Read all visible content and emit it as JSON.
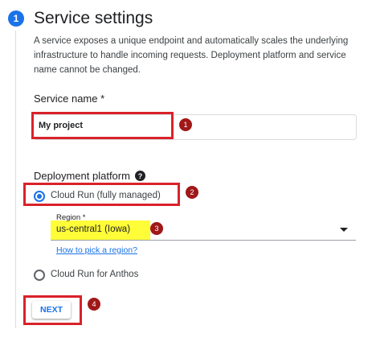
{
  "step": {
    "number": "1",
    "title": "Service settings"
  },
  "description": "A service exposes a unique endpoint and automatically scales the underlying infrastructure to handle incoming requests. Deployment platform and service name cannot be changed.",
  "service_name": {
    "label": "Service name *",
    "value": "My project"
  },
  "deployment": {
    "label": "Deployment platform",
    "help_icon_glyph": "?",
    "options": [
      {
        "label": "Cloud Run (fully managed)",
        "selected": true
      },
      {
        "label": "Cloud Run for Anthos",
        "selected": false
      }
    ],
    "region": {
      "label": "Region *",
      "value": "us-central1 (Iowa)",
      "help_link": "How to pick a region?"
    }
  },
  "next_button": "NEXT",
  "annotations": [
    "1",
    "2",
    "3",
    "4"
  ],
  "colors": {
    "accent": "#1a73e8",
    "highlight_border": "#d9222a",
    "badge": "#a01818",
    "region_highlight": "#fffd38"
  }
}
